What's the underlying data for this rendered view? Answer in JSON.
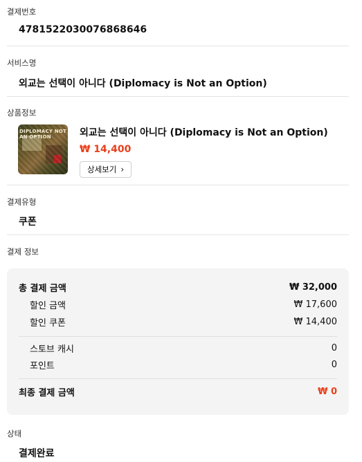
{
  "order": {
    "label": "결제번호",
    "value": "4781522030076868646"
  },
  "service": {
    "label": "서비스명",
    "value": "외교는 선택이 아니다 (Diplomacy is Not an Option)"
  },
  "product": {
    "label": "상품정보",
    "thumbnail_text": "DIPLOMACY NOT AN OPTION",
    "title": "외교는 선택이 아니다 (Diplomacy is Not an Option)",
    "price": "₩ 14,400",
    "detail_button": "상세보기",
    "price_color": "#e8401c"
  },
  "pay_type": {
    "label": "결제유형",
    "value": "쿠폰"
  },
  "pay_info": {
    "label": "결제 정보",
    "total": {
      "label": "총 결제 금액",
      "amount": "₩ 32,000"
    },
    "discount": {
      "label": "할인 금액",
      "amount": "₩ 17,600"
    },
    "coupon": {
      "label": "할인 쿠폰",
      "amount": "₩ 14,400"
    },
    "store_cash": {
      "label": "스토브 캐시",
      "amount": "0"
    },
    "points": {
      "label": "포인트",
      "amount": "0"
    },
    "final": {
      "label": "최종 결제 금액",
      "amount": "₩ 0"
    }
  },
  "status": {
    "label": "상태",
    "value": "결제완료"
  }
}
